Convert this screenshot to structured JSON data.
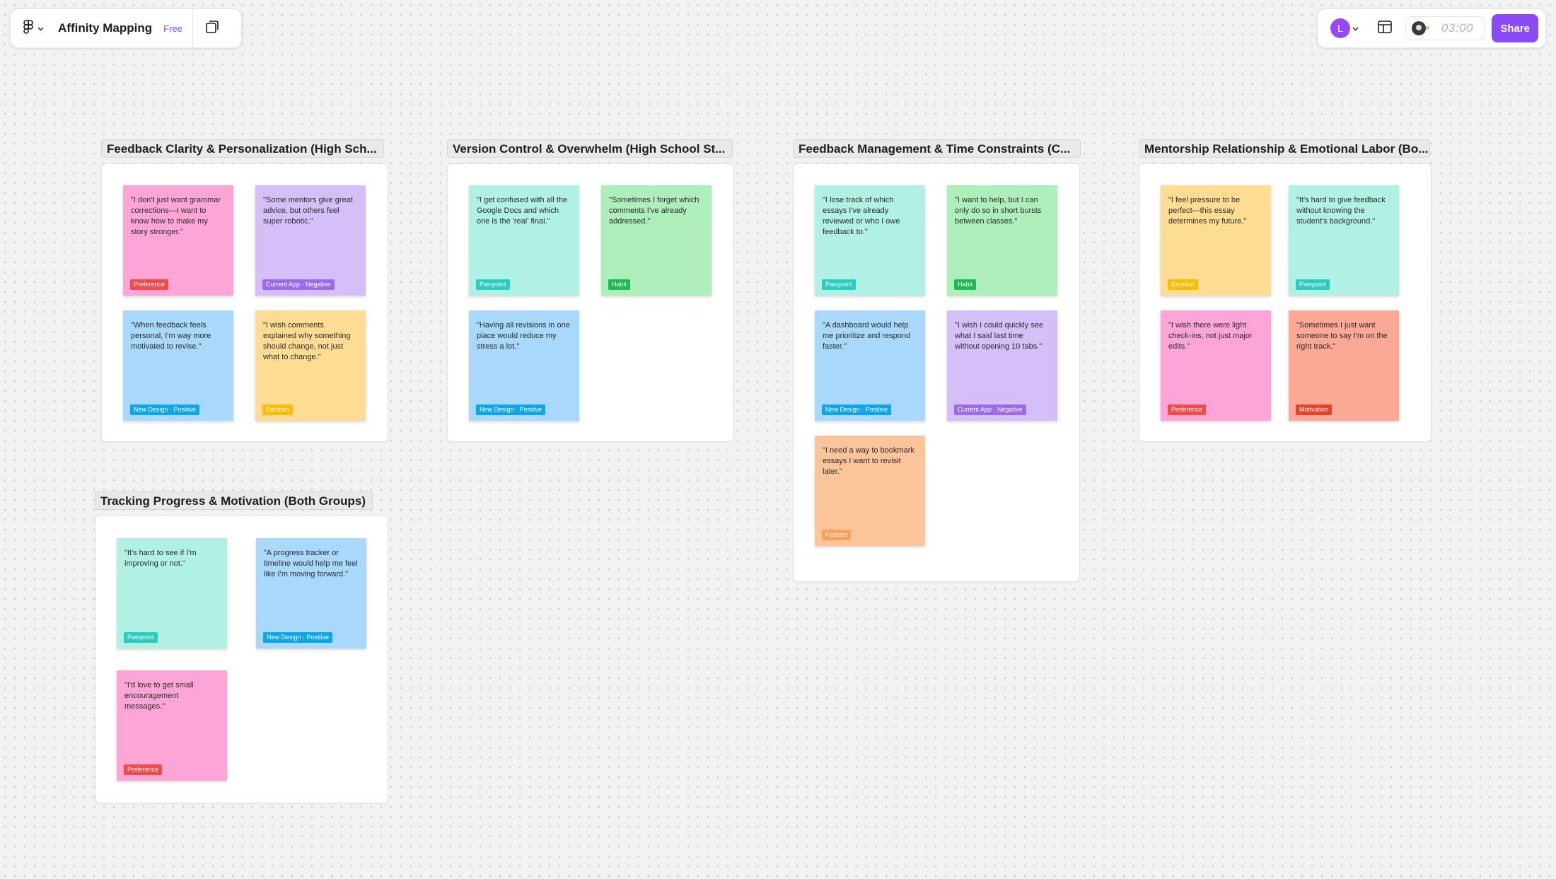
{
  "toolbar": {
    "file_name": "Affinity Mapping",
    "plan_badge": "Free",
    "user_initial": "L",
    "timer": "03:00",
    "share_label": "Share"
  },
  "colors": {
    "pink": "#fca5d6",
    "purple": "#d5bff8",
    "blue": "#a8d8fb",
    "yellow": "#fedc93",
    "teal": "#b0f1e4",
    "green": "#adeebb",
    "orange": "#fcc49b",
    "salmon": "#fca896",
    "accent": "#8a4bf6"
  },
  "sections": [
    {
      "title": "Feedback Clarity & Personalization (High Sch...",
      "notes": [
        {
          "text": "\"I don't just want grammar corrections—I want to know how to make my story stronger.\"",
          "tag": "Preference"
        },
        {
          "text": "\"Some mentors give great advice, but others feel super robotic.\"",
          "tag": "Current App · Negative"
        },
        {
          "text": "\"When feedback feels personal, I'm way more motivated to revise.\"",
          "tag": "New Design · Positive"
        },
        {
          "text": "\"I wish comments explained why something should change, not just what to change.\"",
          "tag": "Emotion"
        }
      ]
    },
    {
      "title": "Version Control & Overwhelm (High School St...",
      "notes": [
        {
          "text": "\"I get confused with all the Google Docs and which one is the 'real' final.\"",
          "tag": "Painpoint"
        },
        {
          "text": "\"Sometimes I forget which comments I've already addressed.\"",
          "tag": "Habit"
        },
        {
          "text": "\"Having all revisions in one place would reduce my stress a lot.\"",
          "tag": "New Design · Positive"
        }
      ]
    },
    {
      "title": "Feedback Management & Time Constraints (C...",
      "notes": [
        {
          "text": "\"I lose track of which essays I've already reviewed or who I owe feedback to.\"",
          "tag": "Painpoint"
        },
        {
          "text": "\"I want to help, but I can only do so in short bursts between classes.\"",
          "tag": "Habit"
        },
        {
          "text": "\"A dashboard would help me prioritize and respond faster.\"",
          "tag": "New Design · Positive"
        },
        {
          "text": "\"I wish I could quickly see what I said last time without opening 10 tabs.\"",
          "tag": "Current App · Negative"
        },
        {
          "text": "\"I need a way to bookmark essays I want to revisit later.\"",
          "tag": "Feature"
        }
      ]
    },
    {
      "title": "Mentorship Relationship & Emotional Labor (Bo...",
      "notes": [
        {
          "text": "\"I feel pressure to be perfect—this essay determines my future.\"",
          "tag": "Emotion"
        },
        {
          "text": "\"It's hard to give feedback without knowing the student's background.\"",
          "tag": "Painpoint"
        },
        {
          "text": "\"I wish there were light check-ins, not just major edits.\"",
          "tag": "Preference"
        },
        {
          "text": "\"Sometimes I just want someone to say I'm on the right track.\"",
          "tag": "Motivation"
        }
      ]
    },
    {
      "title": "Tracking Progress & Motivation (Both Groups)",
      "notes": [
        {
          "text": "\"It's hard to see if I'm improving or not.\"",
          "tag": "Painpoint"
        },
        {
          "text": "\"A progress tracker or timeline would help me feel like I'm moving forward.\"",
          "tag": "New Design · Positive"
        },
        {
          "text": "\"I'd love to get small encouragement messages.\"",
          "tag": "Preference"
        }
      ]
    }
  ]
}
